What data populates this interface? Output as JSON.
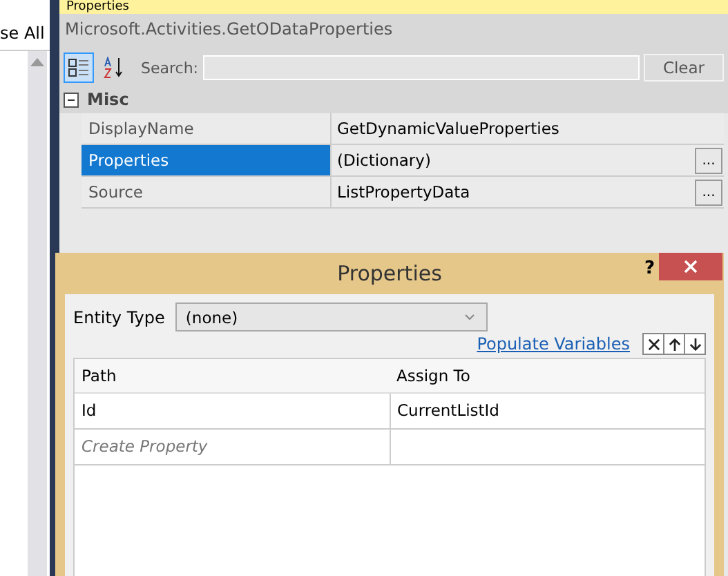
{
  "left_panel": {
    "tab_text": "se All"
  },
  "properties_window": {
    "title": "Properties",
    "object_name": "Microsoft.Activities.GetODataProperties",
    "toolbar": {
      "categorized_selected": true,
      "alphabetical_selected": false,
      "search_label": "Search:",
      "clear_button": "Clear"
    },
    "category": {
      "name": "Misc",
      "expanded": true
    },
    "rows": [
      {
        "name": "DisplayName",
        "value": "GetDynamicValueProperties",
        "selected": false
      },
      {
        "name": "Properties",
        "value": "(Dictionary)",
        "selected": true,
        "button": "..."
      },
      {
        "name": "Source",
        "value": "ListPropertyData",
        "selected": false,
        "button": "..."
      }
    ]
  },
  "dialog": {
    "title": "Properties",
    "help": "?",
    "entity_type_label": "Entity Type",
    "entity_type_value": "(none)",
    "populate_link": "Populate Variables",
    "table": {
      "columns": [
        "Path",
        "Assign To"
      ],
      "rows": [
        [
          "Id",
          "CurrentListId"
        ]
      ],
      "new_row_placeholder": "Create Property"
    }
  }
}
